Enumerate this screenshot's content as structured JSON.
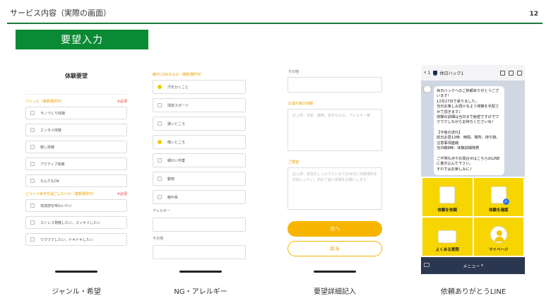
{
  "header": {
    "title": "サービス内容（実際の画面）",
    "page_number": "12",
    "section_label": "要望入力"
  },
  "screens": [
    {
      "heading": "体験要望",
      "genre_label": "ジャンル（複数選択可）",
      "required_label": "※必須",
      "genre_options": [
        "モノづくり体験",
        "エンタメ体験",
        "癒し体験",
        "アクティブ体験",
        "なんでもOK"
      ],
      "purpose_label": "どういう休日を過ごしたいか（複数選択可）",
      "purpose_options": [
        "達成感を味わいたい",
        "ストレス発散したい、スッキリしたい",
        "ワクワクしたい、ドキドキしたい"
      ]
    },
    {
      "ng_label": "絶対にNGなもの（複数選択可）",
      "ng_options": [
        {
          "label": "汗をかくこと",
          "checked": true
        },
        {
          "label": "球技スポーツ",
          "checked": false
        },
        {
          "label": "狭いところ",
          "checked": false
        },
        {
          "label": "暗いところ",
          "checked": true
        },
        {
          "label": "細かい作業",
          "checked": false
        },
        {
          "label": "動物",
          "checked": false
        },
        {
          "label": "絶叫系",
          "checked": false
        }
      ],
      "allergy_label": "アレルギー",
      "other_label": "その他"
    },
    {
      "other_label": "その他",
      "info_label": "お連れ様の情報",
      "info_placeholder": "記入例：年齢、趣味、苦手なもの、アレルギー等",
      "request_label": "ご要望",
      "request_placeholder": "記入例：普段をしっかりたいのでお休日に体験場所をお探ししたい。初めて遊い体験をお願いします。",
      "next_button": "次へ",
      "back_button": "戻る"
    },
    {
      "back_count": "1",
      "chat_name": "休日ハック1",
      "message": "休日ハックへのご依頼ありがとうございます！\n12月27日で承りました。\n当日お楽しみ頂けるよう体験を手配させて頂きます♪\n体験の詳細は当日まで秘密ですのでワクワクしながらお待ちくださいね！\n\n【今後の流れ】\n前日お昼12時：時間、場所、持ち物、注意事項連絡\n当日朝8時：体験詳細発表\n\nご不明な点やお問合せはこちらのLINEに書き込んで下さい。\nそれではお楽しみに♪",
      "menu_items": [
        "体験を依頼",
        "体験を確認",
        "よくある質問",
        "マイページ"
      ],
      "menu_label": "メニュー"
    }
  ],
  "captions": [
    "ジャンル・希望",
    "NG・アレルギー",
    "要望詳細記入",
    "依頼ありがとうLINE"
  ],
  "colors": {
    "accent_green": "#0b8a36",
    "accent_yellow": "#f7b500",
    "line_menu": "#f7d500",
    "line_bar": "#2b3650"
  }
}
